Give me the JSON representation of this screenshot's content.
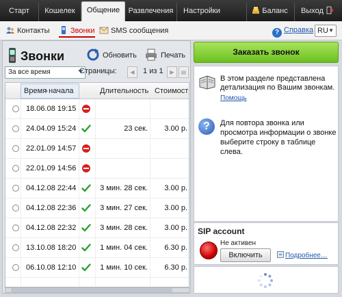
{
  "topnav": {
    "tabs": [
      "Старт",
      "Кошелек",
      "Общение",
      "Развлечения",
      "Настройки"
    ],
    "active": "Общение",
    "balance_label": "Баланс",
    "exit_label": "Выход"
  },
  "subnav": {
    "items": [
      "Контакты",
      "Звонки",
      "SMS сообщения"
    ],
    "active": "Звонки",
    "help_label": "Справка",
    "language": "RU"
  },
  "calls": {
    "title": "Звонки",
    "refresh_label": "Обновить",
    "print_label": "Печать",
    "period": "За все время",
    "pages_label": "Страницы:",
    "page_current": "1",
    "page_of": "из",
    "page_total": "1",
    "columns": [
      "Время начала",
      "Длительность",
      "Стоимость"
    ],
    "rows": [
      {
        "time": "18.06.08 19:15",
        "status": "failed",
        "duration": "",
        "cost": ""
      },
      {
        "time": "24.04.09 15:24",
        "status": "ok",
        "duration": "23 сек.",
        "cost": "3.00 р."
      },
      {
        "time": "22.01.09 14:57",
        "status": "failed",
        "duration": "",
        "cost": ""
      },
      {
        "time": "22.01.09 14:56",
        "status": "failed",
        "duration": "",
        "cost": ""
      },
      {
        "time": "04.12.08 22:44",
        "status": "ok",
        "duration": "3 мин. 28 сек.",
        "cost": "3.00 р."
      },
      {
        "time": "04.12.08 22:36",
        "status": "ok",
        "duration": "3 мин. 27 сек.",
        "cost": "3.00 р."
      },
      {
        "time": "04.12.08 22:32",
        "status": "ok",
        "duration": "3 мин. 28 сек.",
        "cost": "3.00 р."
      },
      {
        "time": "13.10.08 18:20",
        "status": "ok",
        "duration": "1 мин. 04 сек.",
        "cost": "6.30 р."
      },
      {
        "time": "06.10.08 12:10",
        "status": "ok",
        "duration": "1 мин. 10 сек.",
        "cost": "6.30 р."
      }
    ]
  },
  "sidebar": {
    "order_label": "Заказать звонок",
    "info_text": "В этом разделе представлена детализация по Вашим звонкам.",
    "info_link": "Помощь",
    "hint_text": "Для повтора звонка или просмотра информации о звонке выберите строку в таблице слева."
  },
  "sip": {
    "title": "SIP account",
    "status": "Не активен",
    "enable_label": "Включить",
    "more_label": "Подробнее…"
  },
  "colors": {
    "accent_green": "#6cbf1f",
    "status_ok": "#2ca02c",
    "status_failed": "#d62020",
    "link": "#2255aa"
  }
}
